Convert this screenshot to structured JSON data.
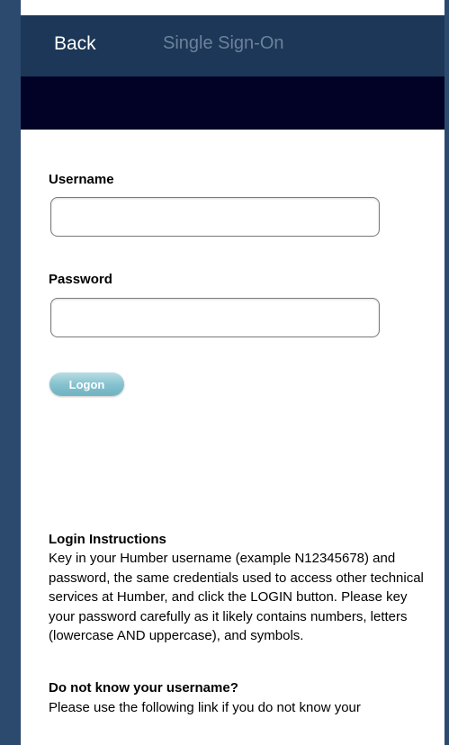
{
  "nav": {
    "back_label": "Back",
    "title": "Single Sign-On"
  },
  "form": {
    "username_label": "Username",
    "username_value": "",
    "password_label": "Password",
    "password_value": "",
    "logon_label": "Logon"
  },
  "instructions": {
    "login_heading": "Login Instructions",
    "login_body": "Key in your Humber username (example N12345678) and password, the same credentials used to access other technical services at Humber, and click the LOGIN button. Please key your password carefully as it likely contains numbers, letters (lowercase AND uppercase), and symbols.",
    "username_heading": "Do not know your username?",
    "username_body": "Please use the following link if you do not know your"
  },
  "colors": {
    "navbar": "#1c3757",
    "darkband": "#010226",
    "border": "#2c4a6e",
    "logon_button": "#86c2cf"
  }
}
